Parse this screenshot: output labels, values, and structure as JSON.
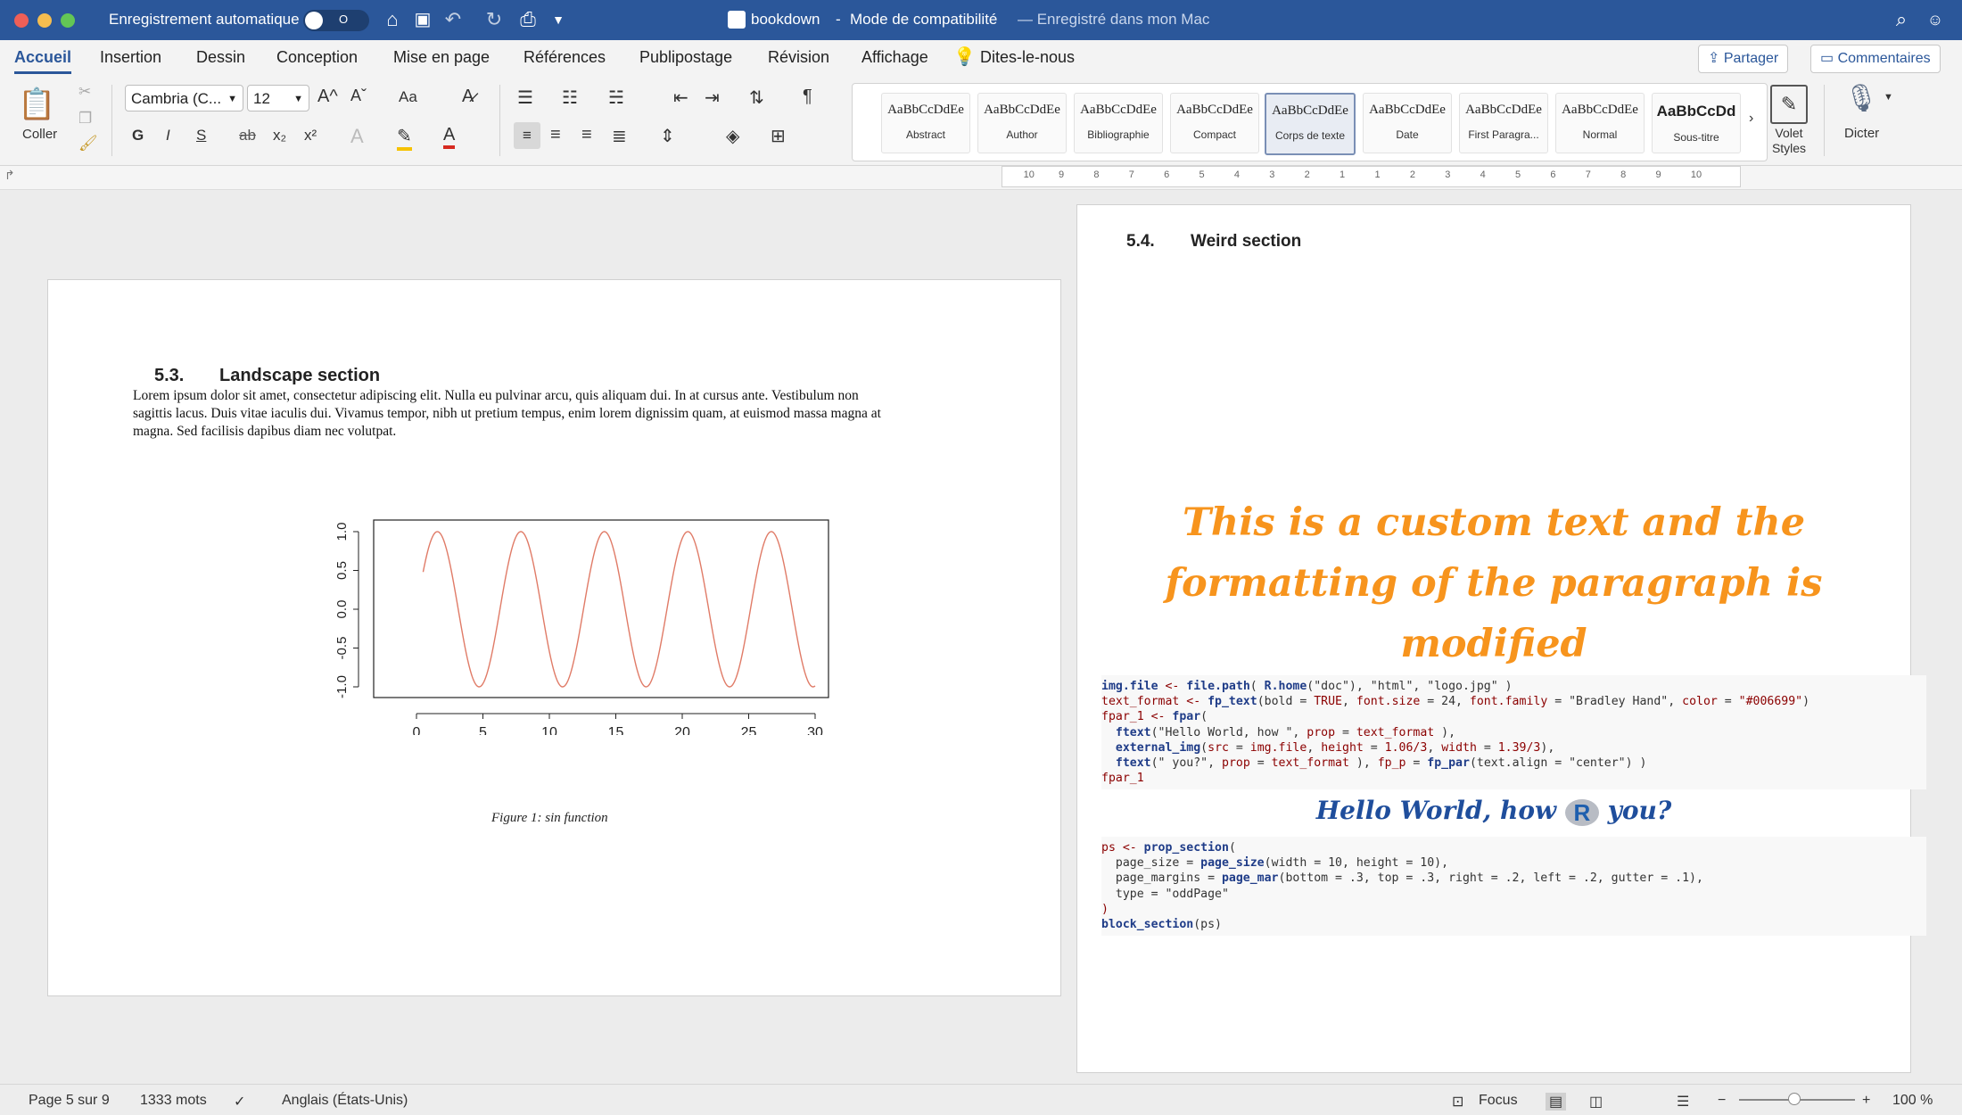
{
  "titlebar": {
    "autosave_label": "Enregistrement automatique",
    "autosave_state": "O",
    "doc_title": "bookdown",
    "separator": "-",
    "mode": "Mode de compatibilité",
    "save_status": "— Enregistré dans mon Mac"
  },
  "ribbon_tabs": [
    "Accueil",
    "Insertion",
    "Dessin",
    "Conception",
    "Mise en page",
    "Références",
    "Publipostage",
    "Révision",
    "Affichage",
    "Dites-le-nous"
  ],
  "share_label": "Partager",
  "comments_label": "Commentaires",
  "ribbon": {
    "paste_label": "Coller",
    "font_name": "Cambria (C...",
    "font_size": "12",
    "bold": "G",
    "italic": "I",
    "underline": "S",
    "strike": "ab",
    "subscript": "x₂",
    "superscript": "x²",
    "case_label": "Aa",
    "grow_font": "A^",
    "shrink_font": "Aˇ",
    "pilcrow": "¶",
    "styles": [
      {
        "preview": "AaBbCcDdEe",
        "name": "Abstract"
      },
      {
        "preview": "AaBbCcDdEe",
        "name": "Author"
      },
      {
        "preview": "AaBbCcDdEe",
        "name": "Bibliographie"
      },
      {
        "preview": "AaBbCcDdEe",
        "name": "Compact"
      },
      {
        "preview": "AaBbCcDdEe",
        "name": "Corps de texte"
      },
      {
        "preview": "AaBbCcDdEe",
        "name": "Date"
      },
      {
        "preview": "AaBbCcDdEe",
        "name": "First Paragra..."
      },
      {
        "preview": "AaBbCcDdEe",
        "name": "Normal"
      },
      {
        "preview": "AaBbCcDd",
        "name": "Sous-titre"
      }
    ],
    "styles_pane_label": "Volet Styles",
    "dictate_label": "Dicter"
  },
  "ruler_ticks": [
    "10",
    "9",
    "8",
    "7",
    "6",
    "5",
    "4",
    "3",
    "2",
    "1",
    "1",
    "2",
    "3",
    "4",
    "5",
    "6",
    "7",
    "8",
    "9",
    "10"
  ],
  "page_left": {
    "heading_num": "5.3.",
    "heading_text": "Landscape section",
    "paragraph_lines": [
      "Lorem ipsum dolor sit amet, consectetur adipiscing elit. Nulla eu pulvinar arcu, quis aliquam dui. In at cursus ante. Vestibulum non",
      "sagittis lacus. Duis vitae iaculis dui. Vivamus tempor, nibh ut pretium tempus, enim lorem dignissim quam, at euismod massa magna at",
      "magna. Sed facilisis dapibus diam nec volutpat."
    ],
    "caption": "Figure 1: sin function"
  },
  "chart_data": {
    "type": "line",
    "title": "",
    "xlabel": "",
    "ylabel": "",
    "xlim": [
      0,
      30
    ],
    "ylim": [
      -1,
      1
    ],
    "x_ticks": [
      "0",
      "5",
      "10",
      "15",
      "20",
      "25",
      "30"
    ],
    "y_ticks": [
      "-1.0",
      "-0.5",
      "0.0",
      "0.5",
      "1.0"
    ],
    "series": [
      {
        "function": "sin(x)",
        "x_start": 0.5,
        "x_end": 30,
        "color": "#e07b67"
      }
    ]
  },
  "page_right": {
    "heading_num": "5.4.",
    "heading_text": "Weird section",
    "custom_text_lines": [
      "This is a custom text and the",
      "formatting of the paragraph is",
      "modified"
    ],
    "code1_lines": [
      [
        [
          "fn",
          "img.file"
        ],
        [
          "kw",
          " <- "
        ],
        [
          "fn",
          "file.path"
        ],
        [
          "str",
          "( "
        ],
        [
          "fn",
          "R.home"
        ],
        [
          "str",
          "(\"doc\"), \"html\", \"logo.jpg\" )"
        ]
      ],
      [
        [
          "kw",
          "text_format"
        ],
        [
          "kw",
          " <- "
        ],
        [
          "fn",
          "fp_text"
        ],
        [
          "str",
          "(bold = "
        ],
        [
          "kw",
          "TRUE"
        ],
        [
          "str",
          ", "
        ],
        [
          "kw",
          "font.size"
        ],
        [
          "str",
          " = 24, "
        ],
        [
          "kw",
          "font.family"
        ],
        [
          "str",
          " = \"Bradley Hand\", "
        ],
        [
          "kw",
          "color"
        ],
        [
          "str",
          " = "
        ],
        [
          "kw",
          "\"#006699\""
        ],
        [
          "str",
          ")"
        ]
      ],
      [
        [
          "kw",
          "fpar_1"
        ],
        [
          "kw",
          " <- "
        ],
        [
          "fn",
          "fpar"
        ],
        [
          "str",
          "("
        ]
      ],
      [
        [
          "str",
          "  "
        ],
        [
          "fn",
          "ftext"
        ],
        [
          "str",
          "(\"Hello World, how \", "
        ],
        [
          "kw",
          "prop"
        ],
        [
          "str",
          " = "
        ],
        [
          "kw",
          "text_format"
        ],
        [
          "str",
          " ),"
        ]
      ],
      [
        [
          "str",
          "  "
        ],
        [
          "fn",
          "external_img"
        ],
        [
          "str",
          "("
        ],
        [
          "kw",
          "src"
        ],
        [
          "str",
          " = "
        ],
        [
          "kw",
          "img.file"
        ],
        [
          "str",
          ", "
        ],
        [
          "kw",
          "height"
        ],
        [
          "str",
          " = "
        ],
        [
          "kw",
          "1.06/3"
        ],
        [
          "str",
          ", "
        ],
        [
          "kw",
          "width"
        ],
        [
          "str",
          " = "
        ],
        [
          "kw",
          "1.39/3"
        ],
        [
          "str",
          "),"
        ]
      ],
      [
        [
          "str",
          "  "
        ],
        [
          "fn",
          "ftext"
        ],
        [
          "str",
          "(\" you?\", "
        ],
        [
          "kw",
          "prop"
        ],
        [
          "str",
          " = "
        ],
        [
          "kw",
          "text_format"
        ],
        [
          "str",
          " ), "
        ],
        [
          "kw",
          "fp_p"
        ],
        [
          "str",
          " = "
        ],
        [
          "fn",
          "fp_par"
        ],
        [
          "str",
          "(text.align = \"center\") )"
        ]
      ],
      [
        [
          "kw",
          "fpar_1"
        ]
      ]
    ],
    "hello_before": "Hello World, how",
    "hello_logo": "R",
    "hello_after": "you?",
    "code2_lines": [
      [
        [
          "kw",
          "ps"
        ],
        [
          "kw",
          " <- "
        ],
        [
          "fn",
          "prop_section"
        ],
        [
          "str",
          "("
        ]
      ],
      [
        [
          "str",
          "  page_size = "
        ],
        [
          "fn",
          "page_size"
        ],
        [
          "str",
          "(width = 10, height = 10),"
        ]
      ],
      [
        [
          "str",
          "  page_margins = "
        ],
        [
          "fn",
          "page_mar"
        ],
        [
          "str",
          "(bottom = .3, top = .3, right = .2, left = .2, gutter = .1),"
        ]
      ],
      [
        [
          "str",
          "  type = \"oddPage\""
        ]
      ],
      [
        [
          "kw",
          ")"
        ]
      ],
      [
        [
          "fn",
          "block_section"
        ],
        [
          "str",
          "(ps)"
        ]
      ]
    ]
  },
  "statusbar": {
    "page": "Page 5 sur 9",
    "words": "1333 mots",
    "language": "Anglais (États-Unis)",
    "focus": "Focus",
    "zoom": "100 %"
  }
}
